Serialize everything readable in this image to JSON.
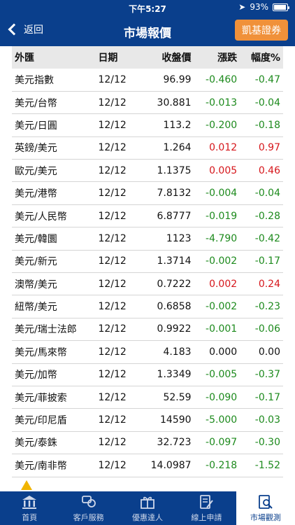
{
  "status": {
    "carrier": "",
    "time": "下午5:27",
    "battery": "93%",
    "battery_level": 0.93
  },
  "nav": {
    "back_label": "返回",
    "title": "市場報價",
    "promo_label": "凱基證券"
  },
  "table": {
    "headers": [
      "外匯",
      "日期",
      "收盤價",
      "漲跌",
      "幅度%"
    ],
    "rows": [
      {
        "name": "美元指數",
        "date": "12/12",
        "price": "96.99",
        "change": "-0.460",
        "pct": "-0.47",
        "trend": "down"
      },
      {
        "name": "美元/台幣",
        "date": "12/12",
        "price": "30.881",
        "change": "-0.013",
        "pct": "-0.04",
        "trend": "down"
      },
      {
        "name": "美元/日圓",
        "date": "12/12",
        "price": "113.2",
        "change": "-0.200",
        "pct": "-0.18",
        "trend": "down"
      },
      {
        "name": "英鎊/美元",
        "date": "12/12",
        "price": "1.264",
        "change": "0.012",
        "pct": "0.97",
        "trend": "up"
      },
      {
        "name": "歐元/美元",
        "date": "12/12",
        "price": "1.1375",
        "change": "0.005",
        "pct": "0.46",
        "trend": "up"
      },
      {
        "name": "美元/港幣",
        "date": "12/12",
        "price": "7.8132",
        "change": "-0.004",
        "pct": "-0.04",
        "trend": "down"
      },
      {
        "name": "美元/人民幣",
        "date": "12/12",
        "price": "6.8777",
        "change": "-0.019",
        "pct": "-0.28",
        "trend": "down"
      },
      {
        "name": "美元/韓圜",
        "date": "12/12",
        "price": "1123",
        "change": "-4.790",
        "pct": "-0.42",
        "trend": "down"
      },
      {
        "name": "美元/新元",
        "date": "12/12",
        "price": "1.3714",
        "change": "-0.002",
        "pct": "-0.17",
        "trend": "down"
      },
      {
        "name": "澳幣/美元",
        "date": "12/12",
        "price": "0.7222",
        "change": "0.002",
        "pct": "0.24",
        "trend": "up"
      },
      {
        "name": "紐幣/美元",
        "date": "12/12",
        "price": "0.6858",
        "change": "-0.002",
        "pct": "-0.23",
        "trend": "down"
      },
      {
        "name": "美元/瑞士法郎",
        "date": "12/12",
        "price": "0.9922",
        "change": "-0.001",
        "pct": "-0.06",
        "trend": "down"
      },
      {
        "name": "美元/馬來幣",
        "date": "12/12",
        "price": "4.183",
        "change": "0.000",
        "pct": "0.00",
        "trend": "flat"
      },
      {
        "name": "美元/加幣",
        "date": "12/12",
        "price": "1.3349",
        "change": "-0.005",
        "pct": "-0.37",
        "trend": "down"
      },
      {
        "name": "美元/菲披索",
        "date": "12/12",
        "price": "52.59",
        "change": "-0.090",
        "pct": "-0.17",
        "trend": "down"
      },
      {
        "name": "美元/印尼盾",
        "date": "12/12",
        "price": "14590",
        "change": "-5.000",
        "pct": "-0.03",
        "trend": "down"
      },
      {
        "name": "美元/泰銖",
        "date": "12/12",
        "price": "32.723",
        "change": "-0.097",
        "pct": "-0.30",
        "trend": "down"
      },
      {
        "name": "美元/南非幣",
        "date": "12/12",
        "price": "14.0987",
        "change": "-0.218",
        "pct": "-1.52",
        "trend": "down"
      }
    ]
  },
  "tabs": [
    {
      "label": "首頁",
      "icon": "bank-icon",
      "active": false
    },
    {
      "label": "客戶服務",
      "icon": "customer-service-icon",
      "active": false
    },
    {
      "label": "優惠達人",
      "icon": "gift-icon",
      "active": false
    },
    {
      "label": "線上申請",
      "icon": "document-pen-icon",
      "active": false
    },
    {
      "label": "市場觀測",
      "icon": "market-watch-icon",
      "active": true
    }
  ],
  "colors": {
    "brand_blue": "#0a3f8c",
    "promo_orange": "#f0913a",
    "up_red": "#d6161b",
    "down_green": "#1d8a1d"
  }
}
